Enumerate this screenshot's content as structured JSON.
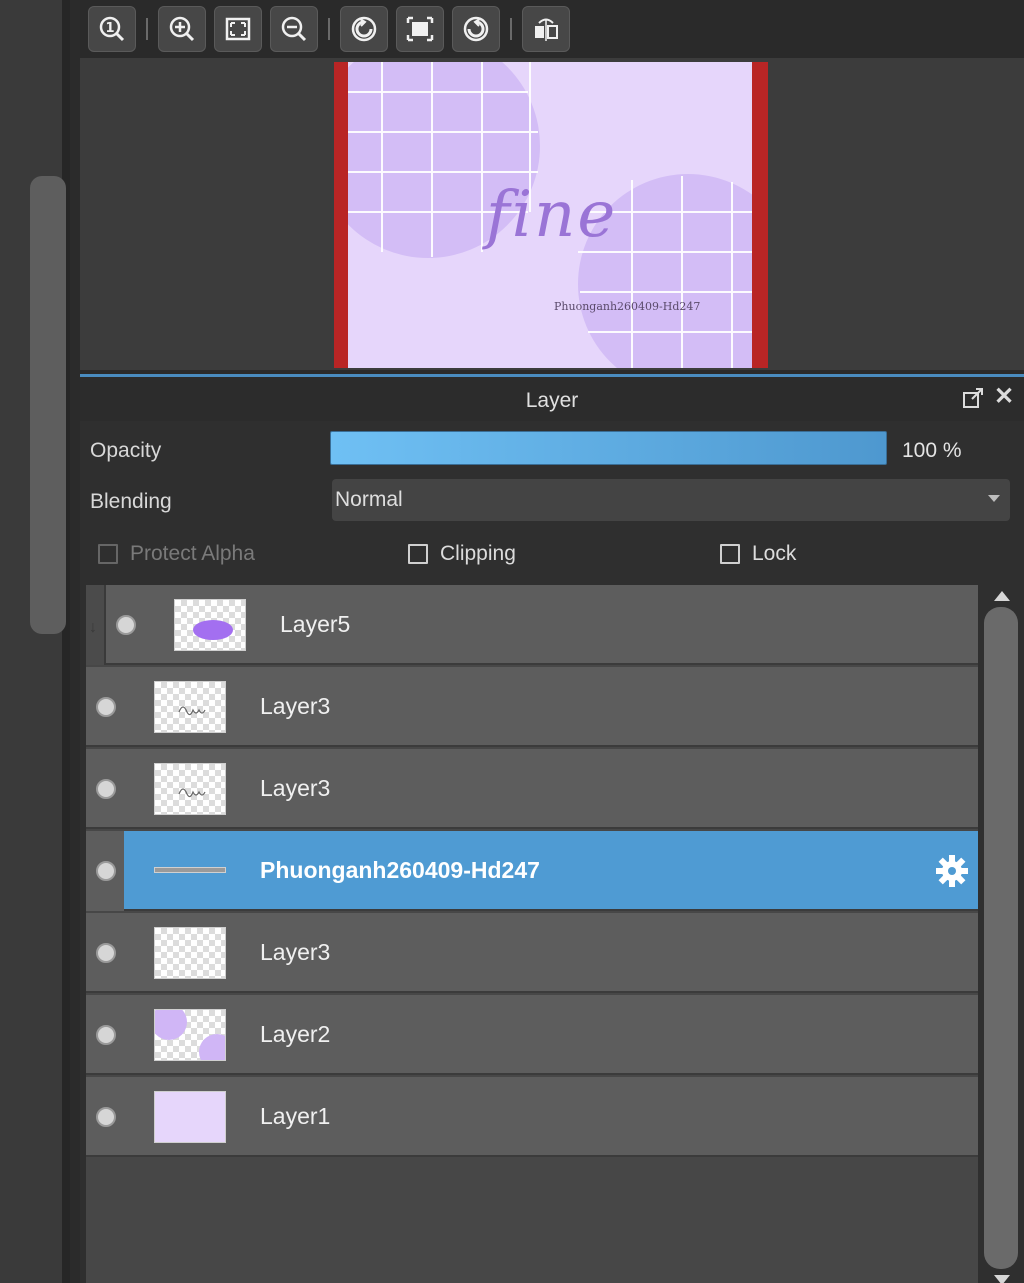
{
  "toolbar": {
    "buttons": [
      {
        "icon": "zoom-actual-icon"
      },
      {
        "icon": "zoom-in-icon"
      },
      {
        "icon": "fit-window-icon"
      },
      {
        "icon": "zoom-out-icon"
      },
      {
        "icon": "rotate-left-icon"
      },
      {
        "icon": "reset-view-icon"
      },
      {
        "icon": "rotate-right-icon"
      },
      {
        "icon": "flip-horizontal-icon"
      }
    ]
  },
  "navigator": {
    "canvas_text": "fine",
    "canvas_signature": "Phuonganh260409-Hd247",
    "canvas_bg": "#e6d6fb",
    "frame_color": "#b92525"
  },
  "panel": {
    "title": "Layer",
    "opacity_label": "Opacity",
    "opacity_value": "100 %",
    "opacity_level": 1.0,
    "blending_label": "Blending",
    "blending_value": "Normal",
    "protect_alpha_label": "Protect Alpha",
    "clipping_label": "Clipping",
    "lock_label": "Lock",
    "accent": "#4f9bd3"
  },
  "layers": [
    {
      "name": "Layer5",
      "clipped": true,
      "thumb": "purple-blob"
    },
    {
      "name": "Layer3",
      "thumb": "fine-sketch"
    },
    {
      "name": "Layer3",
      "thumb": "fine-sketch"
    },
    {
      "name": "Phuonganh260409-Hd247",
      "selected": true,
      "thumb": "text-line"
    },
    {
      "name": "Layer3",
      "thumb": "empty"
    },
    {
      "name": "Layer2",
      "thumb": "purple-corners"
    },
    {
      "name": "Layer1",
      "thumb": "purple-fill"
    }
  ]
}
